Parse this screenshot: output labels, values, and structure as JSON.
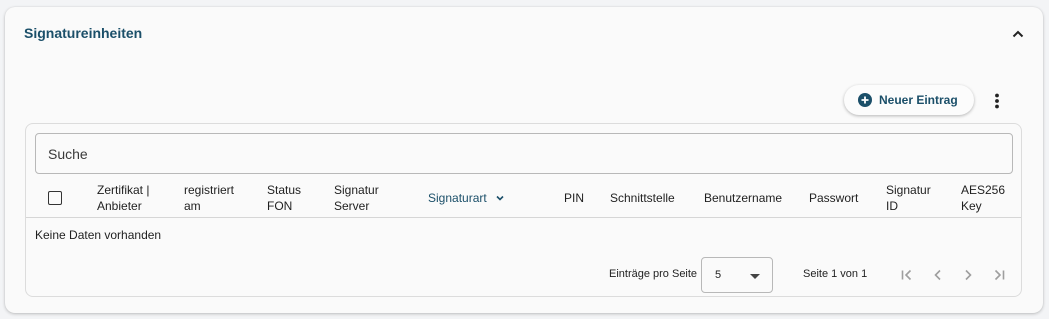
{
  "panel": {
    "title": "Signatureinheiten",
    "collapse_icon": "chevron-up-icon"
  },
  "toolbar": {
    "new_entry_label": "Neuer Eintrag",
    "new_entry_icon": "add-circle-icon",
    "more_icon": "more-vert-icon"
  },
  "search": {
    "placeholder": "Suche",
    "value": ""
  },
  "table": {
    "columns": [
      {
        "line1": "Zertifikat |",
        "line2": "Anbieter"
      },
      {
        "line1": "registriert",
        "line2": "am"
      },
      {
        "line1": "Status",
        "line2": "FON"
      },
      {
        "line1": "Signatur",
        "line2": "Server"
      },
      {
        "line1": "Signaturart",
        "line2": ""
      },
      {
        "line1": "PIN",
        "line2": ""
      },
      {
        "line1": "Schnittstelle",
        "line2": ""
      },
      {
        "line1": "Benutzername",
        "line2": ""
      },
      {
        "line1": "Passwort",
        "line2": ""
      },
      {
        "line1": "Signatur",
        "line2": "ID"
      },
      {
        "line1": "AES256",
        "line2": "Key"
      }
    ],
    "sorted_column": "Signaturart",
    "sort_icon": "chevron-down-icon",
    "empty_text": "Keine Daten vorhanden"
  },
  "pagination": {
    "per_page_label": "Einträge pro Seite",
    "per_page_value": "5",
    "page_info": "Seite 1 von 1",
    "first_icon": "first-page-icon",
    "prev_icon": "chevron-left-icon",
    "next_icon": "chevron-right-icon",
    "last_icon": "last-page-icon"
  },
  "colors": {
    "accent": "#1b4f69",
    "panel_bg": "#fafafa",
    "page_bg": "#f3f4f6",
    "border": "#dcdcdc",
    "disabled_icon": "#9e9e9e"
  }
}
